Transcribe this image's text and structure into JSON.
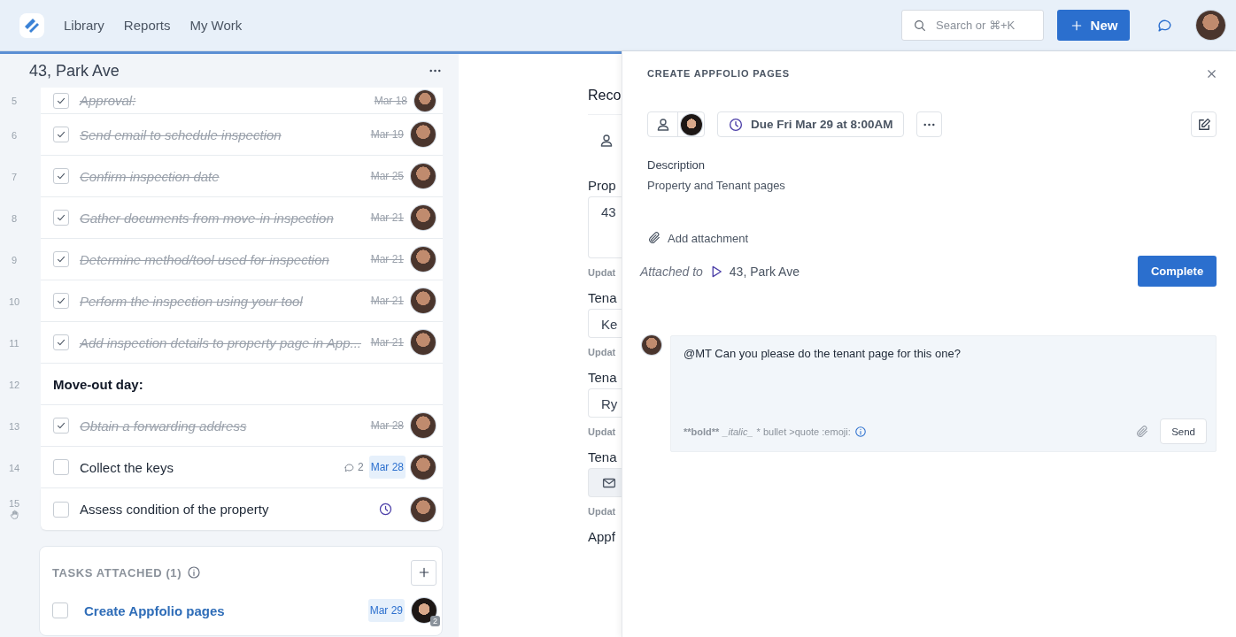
{
  "top_bar": {
    "nav": [
      {
        "label": "Library"
      },
      {
        "label": "Reports"
      },
      {
        "label": "My Work"
      }
    ],
    "search": {
      "placeholder": "Search or ⌘+K"
    },
    "new_button": {
      "label": "New"
    }
  },
  "property": {
    "title": "43, Park Ave",
    "tasks": [
      {
        "kind": "task",
        "number": "5",
        "text": "Approval:",
        "done": true,
        "date": "Mar 18",
        "date_highlighted": false
      },
      {
        "kind": "task",
        "number": "6",
        "text": "Send email to schedule inspection",
        "done": true,
        "date": "Mar 19",
        "date_highlighted": false
      },
      {
        "kind": "task",
        "number": "7",
        "text": "Confirm inspection date",
        "done": true,
        "date": "Mar 25",
        "date_highlighted": false
      },
      {
        "kind": "task",
        "number": "8",
        "text": "Gather documents from move-in inspection",
        "done": true,
        "date": "Mar 21",
        "date_highlighted": false
      },
      {
        "kind": "task",
        "number": "9",
        "text": "Determine method/tool used for inspection",
        "done": true,
        "date": "Mar 21",
        "date_highlighted": false
      },
      {
        "kind": "task",
        "number": "10",
        "text": "Perform the inspection using your tool",
        "done": true,
        "date": "Mar 21",
        "date_highlighted": false
      },
      {
        "kind": "task",
        "number": "11",
        "text": "Add inspection details to property page in App...",
        "done": true,
        "date": "Mar 21",
        "date_highlighted": false
      },
      {
        "kind": "heading",
        "number": "12",
        "text": "Move-out day:"
      },
      {
        "kind": "task",
        "number": "13",
        "text": "Obtain a forwarding address",
        "done": true,
        "date": "Mar 28",
        "date_highlighted": false
      },
      {
        "kind": "task",
        "number": "14",
        "text": "Collect the keys",
        "done": false,
        "comments": "2",
        "date": "Mar 28",
        "date_highlighted": true
      },
      {
        "kind": "task",
        "number": "15",
        "text": "Assess condition of the property",
        "done": false,
        "reminder": true
      }
    ],
    "attached": {
      "title": "TASKS ATTACHED (1)",
      "tasks": [
        {
          "text": "Create Appfolio pages",
          "done": false,
          "date": "Mar 29",
          "date_highlighted": true,
          "badge": "2"
        }
      ]
    }
  },
  "record": {
    "heading": "Reco",
    "fields": [
      {
        "label": "Prop",
        "value": "43",
        "updated": "Updat"
      },
      {
        "label": "Tena",
        "value": "Ke",
        "updated": "Updat"
      },
      {
        "label": "Tena",
        "value": "Ry",
        "updated": "Updat"
      },
      {
        "label": "Tena",
        "kind": "email",
        "updated": "Updat"
      },
      {
        "label": "Appf"
      }
    ]
  },
  "drawer": {
    "title": "CREATE APPFOLIO PAGES",
    "due": "Due Fri Mar 29 at 8:00AM",
    "description_label": "Description",
    "description": "Property and Tenant pages",
    "add_attachment": "Add attachment",
    "attached_label": "Attached to",
    "attached_target": "43, Park Ave",
    "complete_button": "Complete",
    "comment": {
      "value": "@MT Can you please do the tenant page for this one?",
      "hints": [
        {
          "kind": "bold",
          "text": "**bold**"
        },
        {
          "kind": "italic",
          "text": "_italic_"
        },
        {
          "kind": "plain",
          "text": "* bullet >quote :emoji:"
        }
      ],
      "send_button": "Send"
    }
  }
}
